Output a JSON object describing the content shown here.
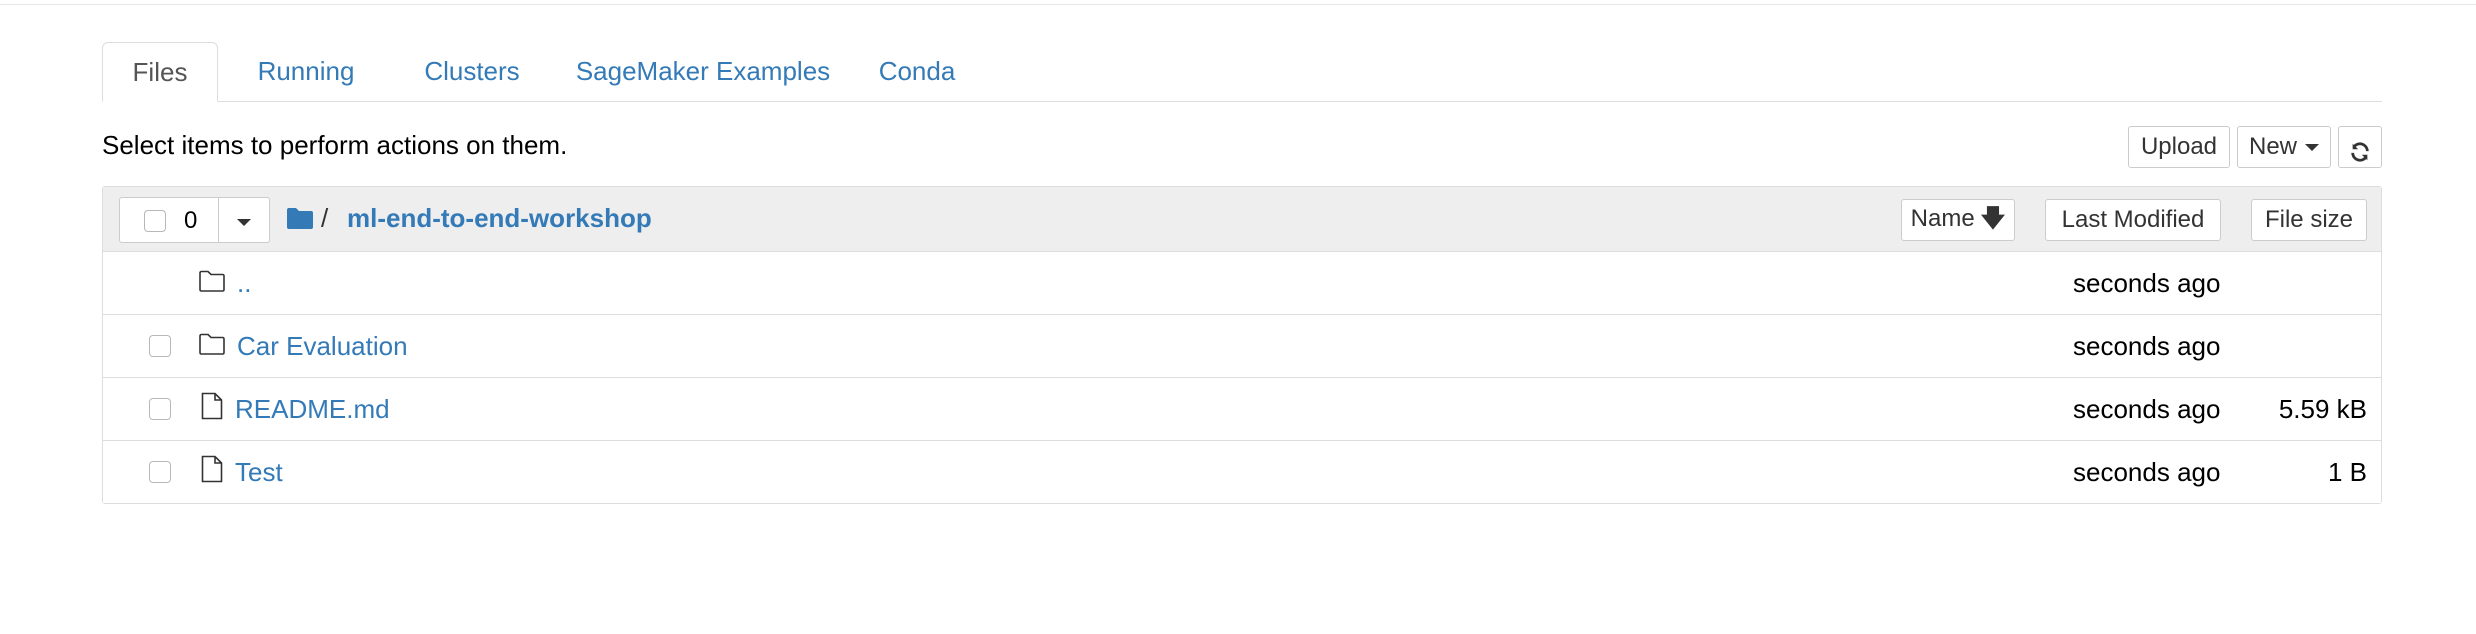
{
  "tabs": [
    {
      "label": "Files",
      "active": true
    },
    {
      "label": "Running",
      "active": false
    },
    {
      "label": "Clusters",
      "active": false
    },
    {
      "label": "SageMaker Examples",
      "active": false
    },
    {
      "label": "Conda",
      "active": false
    }
  ],
  "toolbar": {
    "hint": "Select items to perform actions on them.",
    "upload_label": "Upload",
    "new_label": "New",
    "refresh_icon": "refresh-icon"
  },
  "list_header": {
    "selected_count": "0",
    "breadcrumb_separator": "/",
    "folder_name": "ml-end-to-end-workshop",
    "sort_name_label": "Name",
    "sort_modified_label": "Last Modified",
    "sort_size_label": "File size"
  },
  "items": [
    {
      "name": "..",
      "type": "folder",
      "modified": "seconds ago",
      "size": "",
      "selectable": false
    },
    {
      "name": "Car Evaluation",
      "type": "folder",
      "modified": "seconds ago",
      "size": "",
      "selectable": true
    },
    {
      "name": "README.md",
      "type": "file",
      "modified": "seconds ago",
      "size": "5.59 kB",
      "selectable": true
    },
    {
      "name": "Test",
      "type": "file",
      "modified": "seconds ago",
      "size": "1 B",
      "selectable": true
    }
  ],
  "colors": {
    "link": "#337ab7",
    "border": "#dddddd",
    "header_bg": "#eeeeee"
  }
}
